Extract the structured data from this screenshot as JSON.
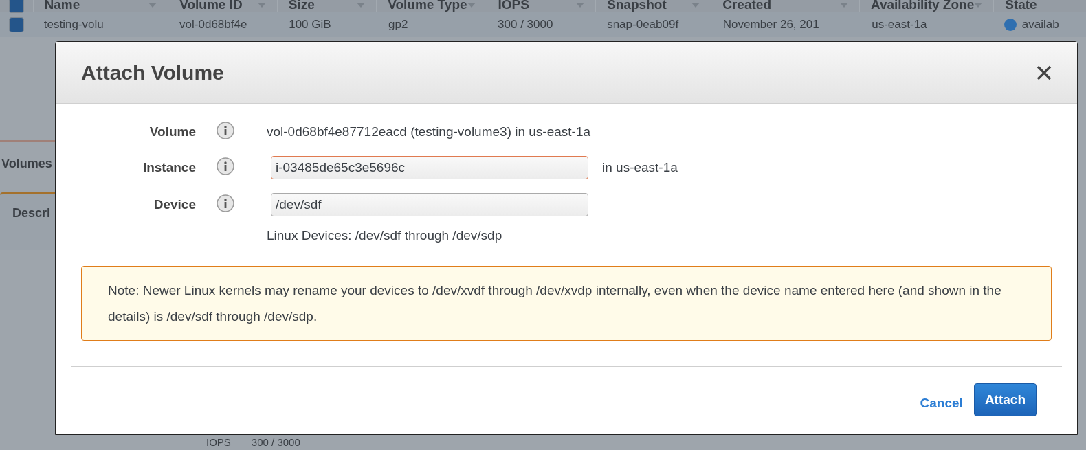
{
  "table": {
    "header_checkbox": {
      "checked": true
    },
    "columns": [
      "Name",
      "Volume ID",
      "Size",
      "Volume Type",
      "IOPS",
      "Snapshot",
      "Created",
      "Availability Zone",
      "State"
    ],
    "rows": [
      {
        "checked": true,
        "cells": [
          "testing-volu",
          "vol-0d68bf4e",
          "100 GiB",
          "gp2",
          "300 / 3000",
          "snap-0eab09f",
          "November 26, 201",
          "us-east-1a",
          "availab"
        ],
        "color": "#2f6fb0"
      }
    ]
  },
  "tabs": [
    {
      "label": "Volumes",
      "selected": false
    },
    {
      "label": "Descri",
      "selected": true
    }
  ],
  "details": {
    "label": "IOPS",
    "value": "300 / 3000"
  },
  "dialog": {
    "title": "Attach Volume",
    "fields": [
      {
        "kind": "text",
        "label": "Volume",
        "value": "vol-0d68bf4e87712eacd (testing-volume3) in us-east-1a"
      },
      {
        "kind": "input",
        "label": "Instance",
        "value": "i-03485de65c3e5696c",
        "suffix": "in us-east-1a",
        "invalid": true
      },
      {
        "kind": "input",
        "label": "Device",
        "value": "/dev/sdf",
        "hint": "Linux Devices: /dev/sdf through /dev/sdp",
        "invalid": false
      }
    ],
    "note": "Note: Newer Linux kernels may rename your devices to /dev/xvdf through /dev/xvdp internally, even when the device name entered here (and shown in the details) is /dev/sdf through /dev/sdp.",
    "buttons": [
      {
        "kind": "link",
        "label": "Cancel"
      },
      {
        "kind": "primary",
        "label": "Attach"
      }
    ]
  }
}
